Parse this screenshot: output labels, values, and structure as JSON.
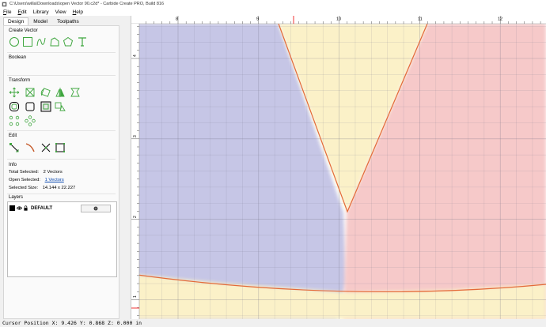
{
  "window": {
    "title": "C:\\Users\\willa\\Downloads\\open Vector 90.c2d* - Carbide Create PRO, Build 816"
  },
  "menu": {
    "items": [
      {
        "label": "File",
        "accel": "F"
      },
      {
        "label": "Edit",
        "accel": "E"
      },
      {
        "label": "Library",
        "accel": ""
      },
      {
        "label": "View",
        "accel": ""
      },
      {
        "label": "Help",
        "accel": "H"
      }
    ]
  },
  "tabs": [
    "Design",
    "Model",
    "Toolpaths"
  ],
  "sections": {
    "create_vector": "Create Vector",
    "boolean": "Boolean",
    "transform": "Transform",
    "edit": "Edit",
    "info": "Info",
    "layers": "Layers"
  },
  "info": {
    "total_selected_label": "Total Selected:",
    "total_selected_value": "2 Vectors",
    "open_selected_label": "Open Selected:",
    "open_selected_value": "1 Vectors",
    "selected_size_label": "Selected Size:",
    "selected_size_value": "14.144 x 22.227"
  },
  "layers": [
    {
      "name": "DEFAULT",
      "color": "#000000"
    }
  ],
  "ruler": {
    "top_labels": [
      "8",
      "9",
      "10",
      "11",
      "12"
    ],
    "left_labels": [
      "4",
      "3",
      "2",
      "1"
    ]
  },
  "status": {
    "text": "Cursor Position X: 9.426 Y: 0.868 Z: 0.000 in"
  },
  "colors": {
    "accent_icon": "#3fa63f",
    "region_blue": "#c6c6e6",
    "region_yellow": "#fbf1c8",
    "region_red": "#f6c9c9",
    "vector_orange": "#e46a38"
  }
}
